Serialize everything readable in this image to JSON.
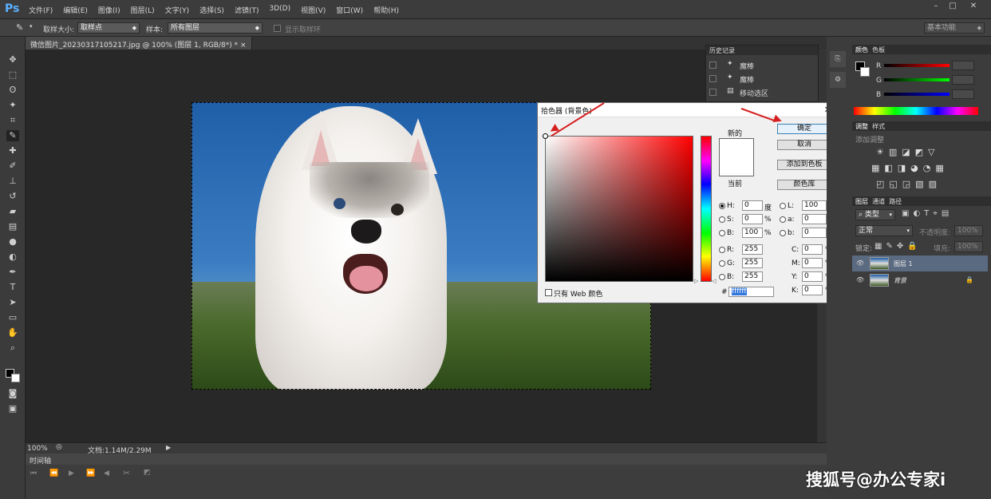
{
  "app": {
    "logo": "Ps",
    "workspace": "基本功能"
  },
  "menu": [
    "文件(F)",
    "编辑(E)",
    "图像(I)",
    "图层(L)",
    "文字(Y)",
    "选择(S)",
    "滤镜(T)",
    "3D(D)",
    "视图(V)",
    "窗口(W)",
    "帮助(H)"
  ],
  "options": {
    "sample_size_label": "取样大小:",
    "sample_size_value": "取样点",
    "sample_label": "样本:",
    "sample_value": "所有图层",
    "show_ring_label": "显示取样环"
  },
  "document": {
    "tab_title": "微信图片_20230317105217.jpg @ 100% (图层 1, RGB/8*) *",
    "zoom": "100%",
    "doc_info": "文档:1.14M/2.29M"
  },
  "timeline": {
    "title": "时间轴"
  },
  "history": {
    "title": "历史记录",
    "items": [
      "魔棒",
      "魔棒",
      "移动选区"
    ]
  },
  "color_picker": {
    "title": "拾色器 (背景色)",
    "new_label": "新的",
    "current_label": "当前",
    "ok": "确定",
    "cancel": "取消",
    "add_to_swatches": "添加到色板",
    "color_libraries": "颜色库",
    "web_only": "只有 Web 颜色",
    "hex_label": "#",
    "hex_value": "ffffff",
    "hsb": [
      {
        "label": "H:",
        "value": "0",
        "unit": "度"
      },
      {
        "label": "S:",
        "value": "0",
        "unit": "%"
      },
      {
        "label": "B:",
        "value": "100",
        "unit": "%"
      }
    ],
    "rgb": [
      {
        "label": "R:",
        "value": "255"
      },
      {
        "label": "G:",
        "value": "255"
      },
      {
        "label": "B:",
        "value": "255"
      }
    ],
    "lab": [
      {
        "label": "L:",
        "value": "100"
      },
      {
        "label": "a:",
        "value": "0"
      },
      {
        "label": "b:",
        "value": "0"
      }
    ],
    "cmyk": [
      {
        "label": "C:",
        "value": "0",
        "unit": "%"
      },
      {
        "label": "M:",
        "value": "0",
        "unit": "%"
      },
      {
        "label": "Y:",
        "value": "0",
        "unit": "%"
      },
      {
        "label": "K:",
        "value": "0",
        "unit": "%"
      }
    ]
  },
  "right_panel": {
    "color_tabs": [
      "颜色",
      "色板"
    ],
    "color_labels": [
      "R",
      "G",
      "B"
    ],
    "adjust_tabs": [
      "调整",
      "样式"
    ],
    "adjust_hint": "添加调整",
    "layer_tabs": [
      "图层",
      "通道",
      "路径"
    ],
    "kind_filter": "类型",
    "blend_mode": "正常",
    "opacity_label": "不透明度:",
    "opacity_value": "100%",
    "lock_label": "锁定:",
    "fill_label": "填充:",
    "fill_value": "100%",
    "layers": [
      {
        "name": "图层 1",
        "selected": true
      },
      {
        "name": "背景",
        "selected": false
      }
    ]
  },
  "watermark": "搜狐号@办公专家i",
  "colors": {
    "accent": "#d61f1f",
    "selection": "#5a6a80"
  }
}
